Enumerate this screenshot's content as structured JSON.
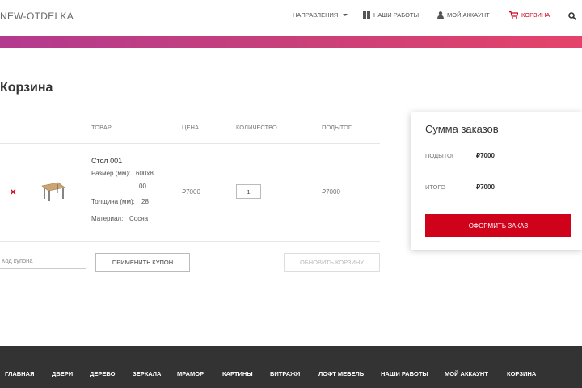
{
  "header": {
    "logo": "NEW-OTDELKA",
    "nav": {
      "directions": "Направления",
      "our_works": "Наши работы",
      "account": "Мой аккаунт",
      "cart": "Корзина"
    }
  },
  "page": {
    "title": "Корзина"
  },
  "cart_table": {
    "headers": {
      "product": "Товар",
      "price": "Цена",
      "quantity": "Количество",
      "subtotal": "Подытог"
    },
    "item": {
      "name": "Стол 001",
      "size_label": "Размер (мм):",
      "size_value_line1": "600x8",
      "size_value_line2": "00",
      "thickness_label": "Толщина (мм):",
      "thickness_value": "28",
      "material_label": "Материал:",
      "material_value": "Сосна",
      "price": "₽7000",
      "quantity": "1",
      "subtotal": "₽7000"
    }
  },
  "coupon": {
    "placeholder": "Код купона",
    "apply_label": "Применить купон",
    "update_label": "Обновить корзину"
  },
  "summary": {
    "title": "Сумма заказов",
    "subtotal_label": "Подытог",
    "subtotal_value": "₽7000",
    "total_label": "Итого",
    "total_value": "₽7000",
    "checkout_label": "Оформить заказ"
  },
  "footer": {
    "nav": [
      "Главная",
      "Двери",
      "Дерево",
      "Зеркала",
      "Мрамор",
      "Картины",
      "Витражи",
      "Лофт мебель",
      "Наши работы",
      "Мой аккаунт",
      "Корзина"
    ]
  },
  "colors": {
    "accent": "#d0021b",
    "footer_bg": "#333333"
  }
}
